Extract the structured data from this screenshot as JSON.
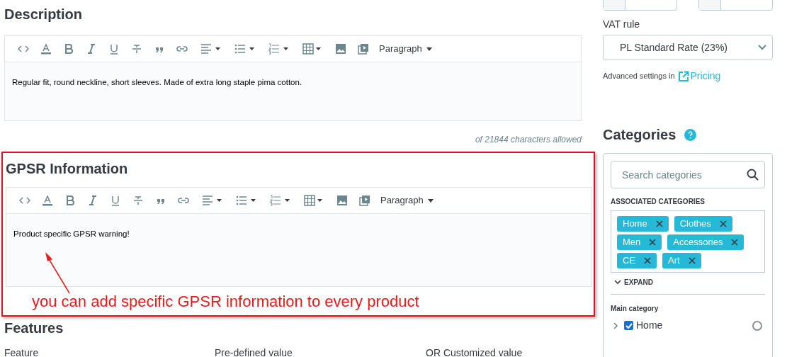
{
  "description": {
    "title": "Description",
    "format": "Paragraph",
    "content": "Regular fit, round neckline, short sleeves. Made of extra long staple pima cotton.",
    "counter": "of 21844 characters allowed"
  },
  "gpsr": {
    "title": "GPSR Information",
    "format": "Paragraph",
    "content": "Product specific GPSR warning!"
  },
  "annotation": "you can add specific GPSR information to every product",
  "features": {
    "title": "Features",
    "columns": [
      "Feature",
      "Pre-defined value",
      "OR Customized value"
    ]
  },
  "vat": {
    "label": "VAT rule",
    "value": "PL Standard Rate (23%)"
  },
  "advanced": {
    "text": "Advanced settings in",
    "link": "Pricing"
  },
  "categories": {
    "title": "Categories",
    "search_placeholder": "Search categories",
    "associated_label": "ASSOCIATED CATEGORIES",
    "tags": [
      "Home",
      "Clothes",
      "Men",
      "Accessories",
      "CE",
      "Art"
    ],
    "expand": "EXPAND",
    "main_label": "Main category",
    "main": {
      "name": "Home",
      "checked": true,
      "selected": false
    }
  }
}
